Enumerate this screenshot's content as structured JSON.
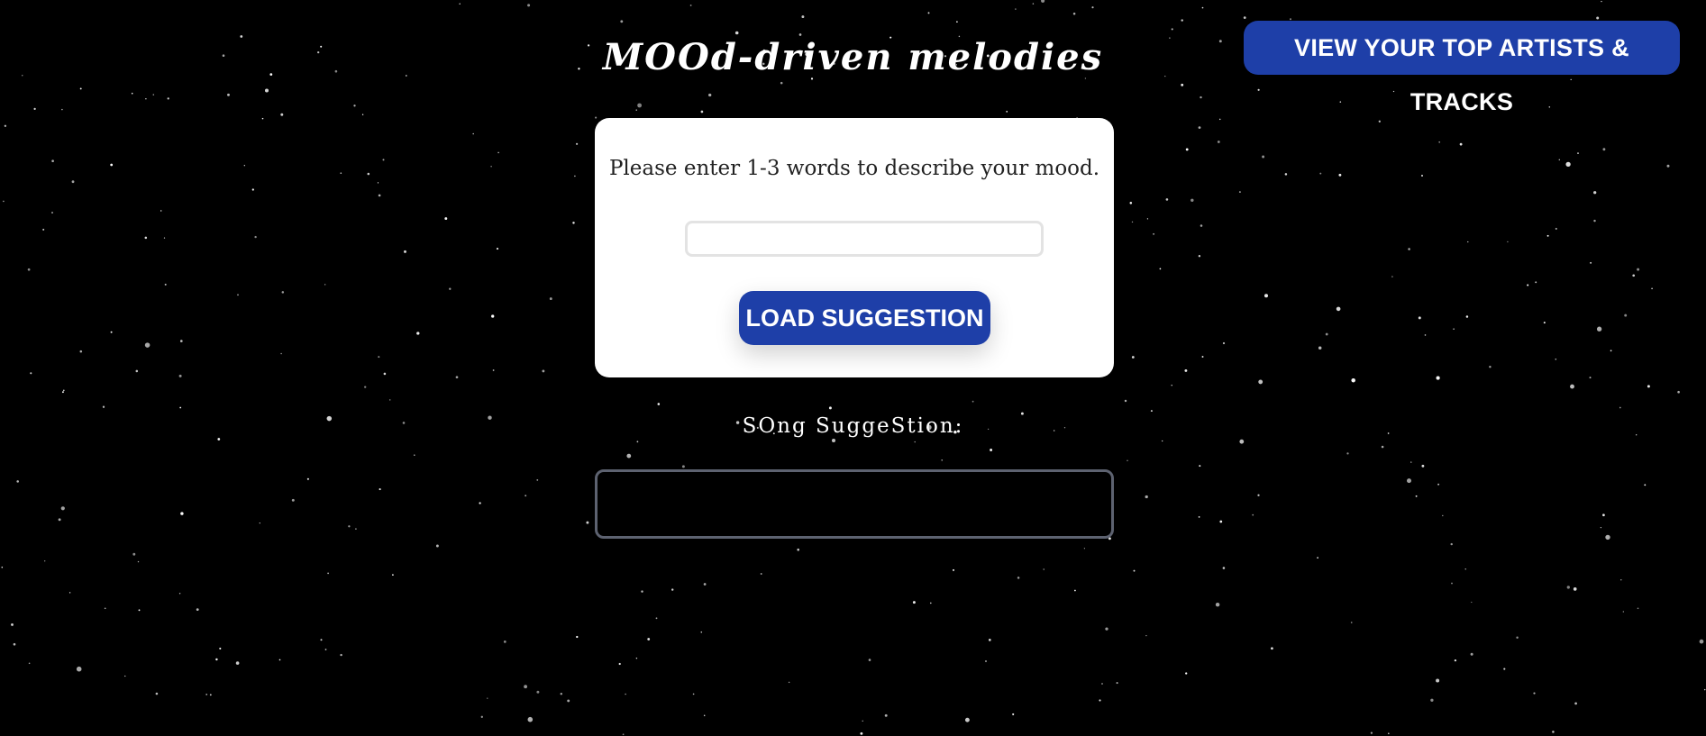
{
  "header": {
    "title": "MOOd-driven melodies",
    "top_button_label": "VIEW YOUR TOP ARTISTS & TRACKS"
  },
  "mood_form": {
    "prompt": "Please enter 1-3 words to describe your mood.",
    "input_value": "",
    "input_placeholder": "",
    "submit_label": "LOAD SUGGESTION"
  },
  "suggestion": {
    "heading": "SOng SuggeStion:",
    "result_text": ""
  },
  "colors": {
    "background": "#000000",
    "accent": "#1e3fa8",
    "card": "#ffffff",
    "result_border": "#5d6270"
  }
}
